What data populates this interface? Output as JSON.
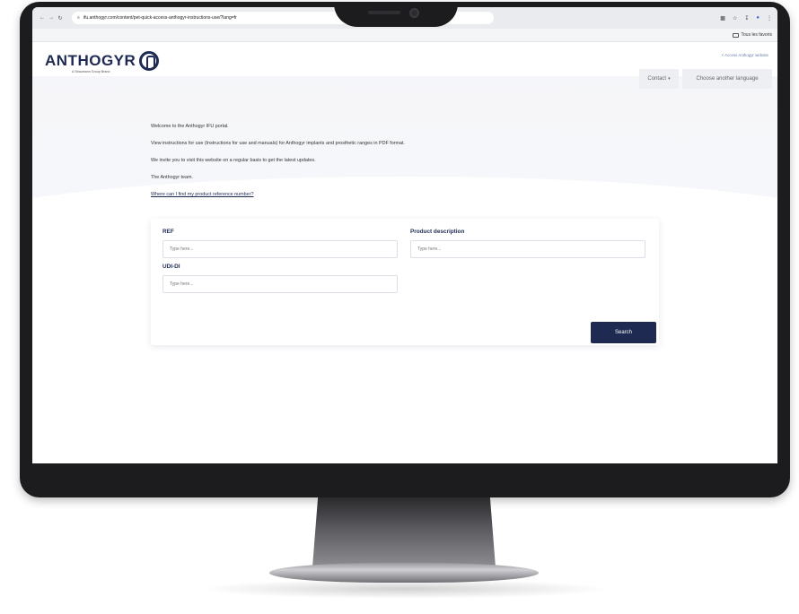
{
  "browser": {
    "url": "ifu.anthogyr.com/content/pet-quick-access-anthogyr-instructions-use/?lang=fr",
    "bookmark_folder": "Tous les favoris"
  },
  "header": {
    "logo_text": "ANTHOGYR",
    "logo_subtitle": "A Straumann Group Brand",
    "access_link": "< Access Anthogyr website",
    "contact_label": "Contact",
    "language_label": "Choose another language"
  },
  "intro": {
    "line1": "Welcome to the Anthogyr IFU portal.",
    "line2": "View instructions for use (Instructions for use and manuals) for Anthogyr implants and prosthetic ranges in PDF format.",
    "line3": "We invite you to visit this website on a regular basis to get the latest updates.",
    "line4": "The Anthogyr team.",
    "link": "Where can I find my product reference number?"
  },
  "search": {
    "ref_label": "REF",
    "ref_placeholder": "Type here...",
    "desc_label": "Product description",
    "desc_placeholder": "Type here...",
    "udi_label": "UDI-DI",
    "udi_placeholder": "Type here...",
    "button_label": "Search"
  },
  "colors": {
    "brand_navy": "#1e2a52",
    "page_bg": "#f5f6f9",
    "bezel": "#1c1c1e"
  }
}
